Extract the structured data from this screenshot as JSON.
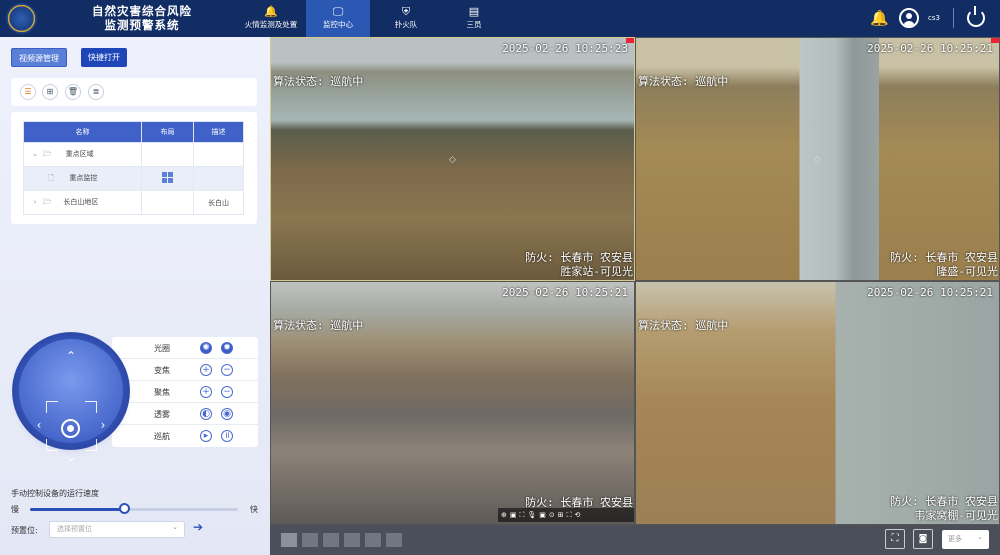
{
  "header": {
    "title_line1": "自然灾害综合风险",
    "title_line2": "监测预警系统",
    "nav": [
      {
        "label": "火情监测及处置",
        "icon": "bell-icon"
      },
      {
        "label": "监控中心",
        "icon": "monitor-icon"
      },
      {
        "label": "扑火队",
        "icon": "team-icon"
      },
      {
        "label": "三员",
        "icon": "document-icon"
      }
    ],
    "active_nav": "监控中心",
    "username": "cs3"
  },
  "left": {
    "btn_video_source": "视频源管理",
    "btn_quick_open": "快捷打开",
    "table": {
      "headers": [
        "名称",
        "布局",
        "描述"
      ],
      "rows": [
        {
          "name": "重点区域",
          "layout": "",
          "desc": ""
        },
        {
          "name": "重点监控",
          "layout": "grid",
          "desc": ""
        },
        {
          "name": "长白山地区",
          "layout": "",
          "desc": "长白山"
        }
      ]
    },
    "controls": [
      "光圈",
      "变焦",
      "聚焦",
      "透雾",
      "巡航"
    ],
    "speed_label": "手动控制设备的运行速度",
    "slow": "慢",
    "fast": "快",
    "speed_value": 0.45,
    "preset_label": "预置位:",
    "preset_placeholder": "选择预置位"
  },
  "videos": [
    {
      "timestamp": "2025-02-26 10:25:23",
      "algo": "算法状态: 巡航中",
      "loc1": "防火: 长春市 农安县",
      "loc2": "胜家站-可见光"
    },
    {
      "timestamp": "2025-02-26 10:25:21",
      "algo": "算法状态: 巡航中",
      "loc1": "防火: 长春市 农安县",
      "loc2": "隆盛-可见光"
    },
    {
      "timestamp": "2025-02-26 10:25:21",
      "algo": "算法状态: 巡航中",
      "loc1": "防火: 长春市 农安县",
      "loc2": ""
    },
    {
      "timestamp": "2025-02-26 10:25:21",
      "algo": "算法状态: 巡航中",
      "loc1": "防火: 长春市 农安县",
      "loc2": "韦家窝棚-可见光"
    }
  ],
  "bottom": {
    "more": "更多"
  }
}
